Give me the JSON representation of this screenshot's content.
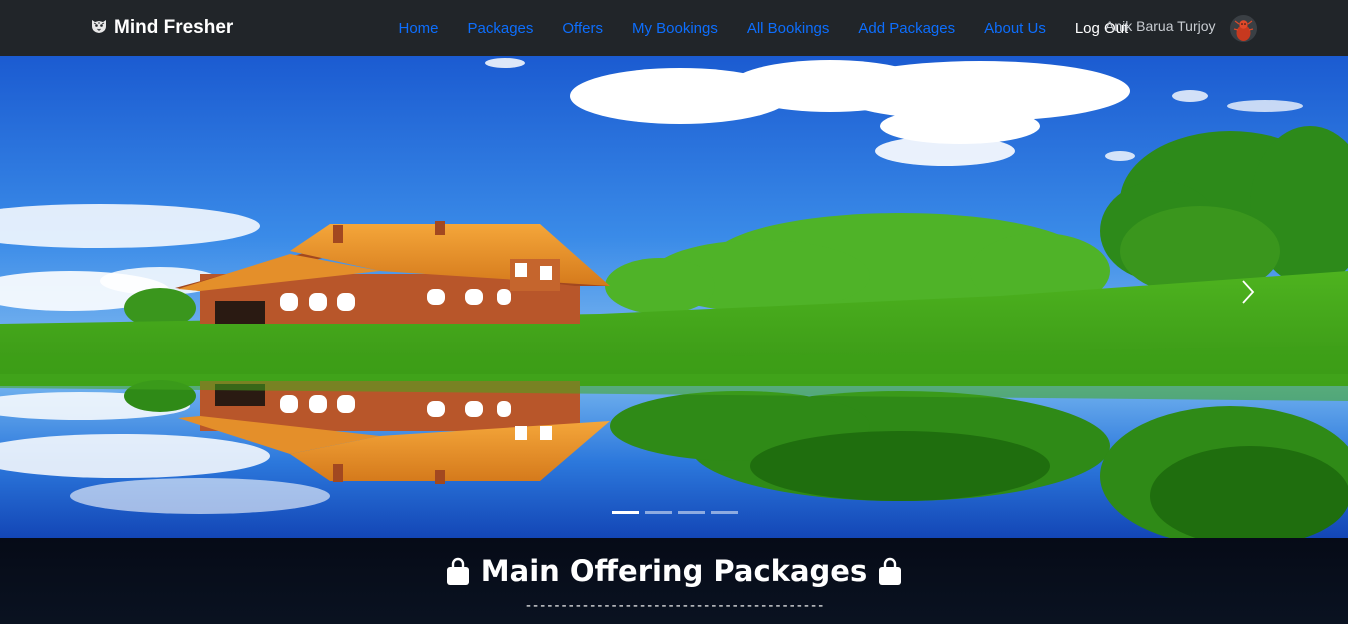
{
  "navbar": {
    "brand": {
      "icon": "tiger-icon",
      "label": "Mind Fresher"
    },
    "links": [
      {
        "label": "Home"
      },
      {
        "label": "Packages"
      },
      {
        "label": "Offers"
      },
      {
        "label": "My Bookings"
      },
      {
        "label": "All Bookings"
      },
      {
        "label": "Add Packages"
      },
      {
        "label": "About Us"
      }
    ],
    "logout_label": "Log Out",
    "user_name": "Anik Barua Turjoy",
    "avatar_icon": "user-avatar",
    "link_color": "#0d6efd",
    "background": "#212529"
  },
  "carousel": {
    "prev_icon": "chevron-left-icon",
    "next_icon": "chevron-right-icon",
    "slide_count": 4,
    "active_slide": 1
  },
  "packages": {
    "title": "Main Offering Packages",
    "title_icon": "shopping-bag-icon",
    "divider": "------------------------------------------"
  }
}
